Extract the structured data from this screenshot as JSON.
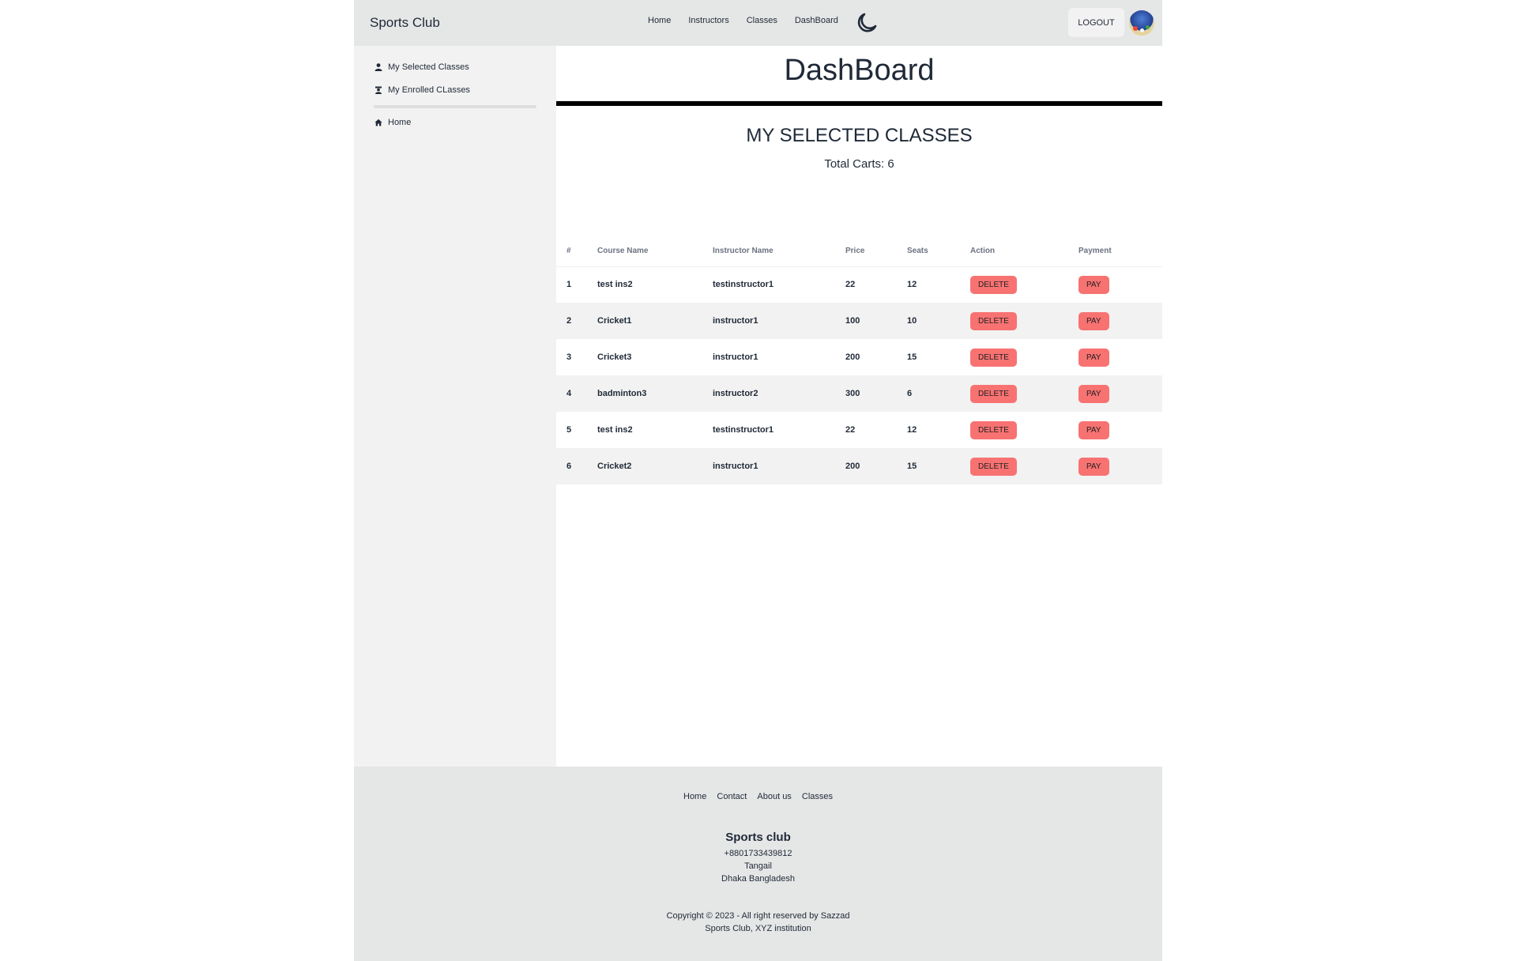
{
  "navbar": {
    "brand": "Sports Club",
    "links": [
      "Home",
      "Instructors",
      "Classes",
      "DashBoard"
    ],
    "theme_icon": "moon-icon",
    "logout_label": "LOGOUT"
  },
  "sidebar": {
    "items": [
      {
        "label": "My Selected Classes",
        "icon": "user-icon"
      },
      {
        "label": "My Enrolled CLasses",
        "icon": "enrolled-icon"
      },
      {
        "label": "Home",
        "icon": "home-icon"
      }
    ]
  },
  "main": {
    "title": "DashBoard",
    "section_title": "MY SELECTED CLASSES",
    "total": "Total Carts: 6",
    "table": {
      "headers": [
        "#",
        "Course Name",
        "Instructor Name",
        "Price",
        "Seats",
        "Action",
        "Payment"
      ],
      "rows": [
        {
          "num": "1",
          "course": "test ins2",
          "instructor": "testinstructor1",
          "price": "22",
          "seats": "12",
          "action": "DELETE",
          "payment": "PAY"
        },
        {
          "num": "2",
          "course": "Cricket1",
          "instructor": "instructor1",
          "price": "100",
          "seats": "10",
          "action": "DELETE",
          "payment": "PAY"
        },
        {
          "num": "3",
          "course": "Cricket3",
          "instructor": "instructor1",
          "price": "200",
          "seats": "15",
          "action": "DELETE",
          "payment": "PAY"
        },
        {
          "num": "4",
          "course": "badminton3",
          "instructor": "instructor2",
          "price": "300",
          "seats": "6",
          "action": "DELETE",
          "payment": "PAY"
        },
        {
          "num": "5",
          "course": "test ins2",
          "instructor": "testinstructor1",
          "price": "22",
          "seats": "12",
          "action": "DELETE",
          "payment": "PAY"
        },
        {
          "num": "6",
          "course": "Cricket2",
          "instructor": "instructor1",
          "price": "200",
          "seats": "15",
          "action": "DELETE",
          "payment": "PAY"
        }
      ]
    }
  },
  "footer": {
    "links": [
      "Home",
      "Contact",
      "About us",
      "Classes"
    ],
    "brand": "Sports club",
    "phone": "+8801733439812",
    "city": "Tangail",
    "region": "Dhaka Bangladesh",
    "copyright": "Copyright © 2023 - All right reserved by Sazzad",
    "org": "Sports Club, XYZ institution"
  },
  "colors": {
    "navbar_bg": "#e5e6e6",
    "sidebar_bg": "#f2f2f2",
    "button_red": "#f87272"
  }
}
